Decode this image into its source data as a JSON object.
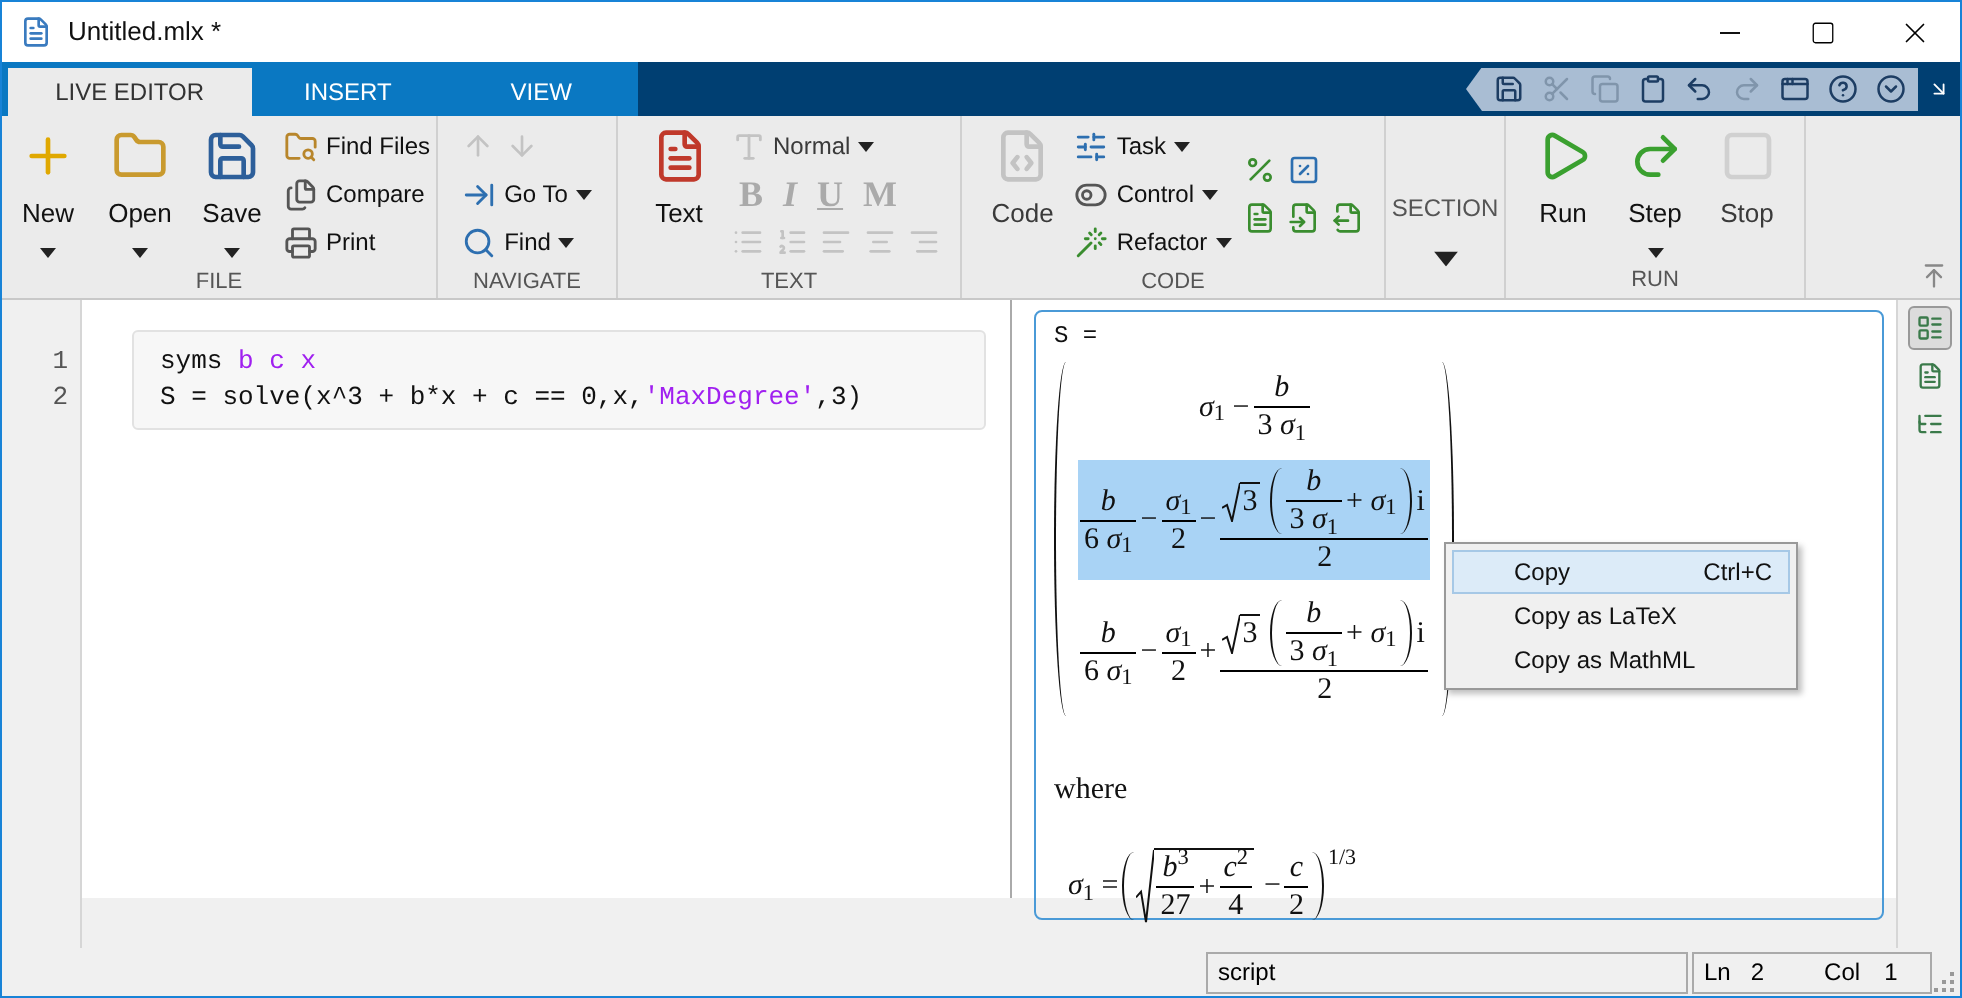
{
  "window": {
    "title": "Untitled.mlx *"
  },
  "tabs": [
    {
      "label": "LIVE EDITOR",
      "selected": true
    },
    {
      "label": "INSERT",
      "selected": false
    },
    {
      "label": "VIEW",
      "selected": false
    }
  ],
  "quick_access": [
    {
      "disabled": false
    },
    {
      "disabled": true
    },
    {
      "disabled": true
    },
    {
      "disabled": false
    },
    {
      "disabled": false
    },
    {
      "disabled": true
    },
    {
      "disabled": false
    },
    {
      "disabled": false
    },
    {
      "disabled": false
    }
  ],
  "ribbon": {
    "groups": [
      {
        "label": "FILE",
        "columns": [
          [
            {
              "kind": "large",
              "label": "New",
              "dropdown": true,
              "disabled": false
            }
          ],
          [
            {
              "kind": "large",
              "label": "Open",
              "dropdown": true,
              "disabled": false
            }
          ],
          [
            {
              "kind": "large",
              "label": "Save",
              "dropdown": true,
              "disabled": false
            }
          ],
          [
            {
              "kind": "small",
              "label": "Find Files",
              "dropdown": false,
              "disabled": false
            },
            {
              "kind": "small",
              "label": "Compare",
              "dropdown": false,
              "disabled": false
            },
            {
              "kind": "small",
              "label": "Print",
              "dropdown": false,
              "disabled": false
            }
          ]
        ]
      },
      {
        "label": "NAVIGATE",
        "columns": [
          [
            {
              "kind": "icons",
              "icons": [
                {
                  "disabled": true
                },
                {
                  "disabled": true
                }
              ]
            },
            {
              "kind": "small",
              "label": "Go To",
              "dropdown": true,
              "disabled": false
            },
            {
              "kind": "small",
              "label": "Find",
              "dropdown": true,
              "disabled": false
            }
          ]
        ]
      },
      {
        "label": "TEXT",
        "columns": [
          [
            {
              "kind": "large",
              "label": "Text",
              "dropdown": false,
              "disabled": false
            }
          ],
          [
            {
              "kind": "small",
              "label": "Normal",
              "dropdown": true,
              "disabled": true
            },
            {
              "kind": "glyphs",
              "glyphs": [
                {
                  "text": "B",
                  "disabled": true
                },
                {
                  "text": "I",
                  "disabled": true
                },
                {
                  "text": "U",
                  "disabled": true
                },
                {
                  "text": "M",
                  "disabled": true
                }
              ]
            },
            {
              "kind": "icons",
              "icons": [
                {
                  "disabled": true
                },
                {
                  "disabled": true
                },
                {
                  "disabled": true
                },
                {
                  "disabled": true
                },
                {
                  "disabled": true
                }
              ]
            }
          ]
        ]
      },
      {
        "label": "CODE",
        "columns": [
          [
            {
              "kind": "large",
              "label": "Code",
              "dropdown": false,
              "disabled": true
            }
          ],
          [
            {
              "kind": "small",
              "label": "Task",
              "dropdown": true,
              "disabled": false
            },
            {
              "kind": "small",
              "label": "Control",
              "dropdown": true,
              "disabled": false
            },
            {
              "kind": "small",
              "label": "Refactor",
              "dropdown": true,
              "disabled": false
            }
          ],
          [
            {
              "kind": "icons",
              "icons": [
                {
                  "disabled": false
                },
                {
                  "disabled": false
                }
              ]
            },
            {
              "kind": "icons",
              "icons": [
                {
                  "disabled": false
                },
                {
                  "disabled": false
                },
                {
                  "disabled": false
                }
              ]
            }
          ]
        ]
      },
      {
        "columns": [
          [
            {
              "kind": "section",
              "label": "SECTION",
              "dropdown": true
            }
          ]
        ]
      },
      {
        "label": "RUN",
        "columns": [
          [
            {
              "kind": "large",
              "label": "Run",
              "dropdown": false,
              "disabled": false
            }
          ],
          [
            {
              "kind": "large",
              "label": "Step",
              "dropdown": true,
              "disabled": false
            }
          ],
          [
            {
              "kind": "large",
              "label": "Stop",
              "dropdown": false,
              "disabled": true
            }
          ]
        ]
      }
    ]
  },
  "editor": {
    "lines": [
      {
        "number": "1",
        "tokens": [
          {
            "text": "syms ",
            "kind": "plain"
          },
          {
            "text": "b c x",
            "kind": "literal"
          }
        ]
      },
      {
        "number": "2",
        "tokens": [
          {
            "text": "S = solve(x^3 + b*x + c == 0,x,",
            "kind": "plain"
          },
          {
            "text": "'MaxDegree'",
            "kind": "literal"
          },
          {
            "text": ",3)",
            "kind": "plain"
          }
        ]
      }
    ]
  },
  "output": {
    "label": "S =",
    "rows": [
      {
        "selected": false,
        "expr": [
          {
            "kind": "t",
            "text": "*σ*$_{1}$ −"
          },
          {
            "kind": "frac",
            "num": [
              {
                "kind": "t",
                "text": "*b*"
              }
            ],
            "den": [
              {
                "kind": "t",
                "text": "3 *σ*$_{1}$"
              }
            ]
          }
        ]
      },
      {
        "selected": true,
        "expr": [
          {
            "kind": "frac",
            "num": [
              {
                "kind": "t",
                "text": "*b*"
              }
            ],
            "den": [
              {
                "kind": "t",
                "text": "6 *σ*$_{1}$"
              }
            ]
          },
          {
            "kind": "t",
            "text": "−"
          },
          {
            "kind": "frac",
            "num": [
              {
                "kind": "t",
                "text": "*σ*$_{1}$"
              }
            ],
            "den": [
              {
                "kind": "t",
                "text": "2"
              }
            ]
          },
          {
            "kind": "t",
            "text": "−"
          },
          {
            "kind": "frac",
            "num": [
              {
                "kind": "sqrt",
                "body": [
                  {
                    "kind": "t",
                    "text": "3"
                  }
                ]
              },
              {
                "kind": "paren",
                "body": [
                  {
                    "kind": "frac",
                    "num": [
                      {
                        "kind": "t",
                        "text": "*b*"
                      }
                    ],
                    "den": [
                      {
                        "kind": "t",
                        "text": "3 *σ*$_{1}$"
                      }
                    ]
                  },
                  {
                    "kind": "t",
                    "text": "+ *σ*$_{1}$"
                  }
                ]
              },
              {
                "kind": "t",
                "text": "i"
              }
            ],
            "den": [
              {
                "kind": "t",
                "text": "2"
              }
            ]
          }
        ]
      },
      {
        "selected": false,
        "expr": [
          {
            "kind": "frac",
            "num": [
              {
                "kind": "t",
                "text": "*b*"
              }
            ],
            "den": [
              {
                "kind": "t",
                "text": "6 *σ*$_{1}$"
              }
            ]
          },
          {
            "kind": "t",
            "text": "−"
          },
          {
            "kind": "frac",
            "num": [
              {
                "kind": "t",
                "text": "*σ*$_{1}$"
              }
            ],
            "den": [
              {
                "kind": "t",
                "text": "2"
              }
            ]
          },
          {
            "kind": "t",
            "text": "+"
          },
          {
            "kind": "frac",
            "num": [
              {
                "kind": "sqrt",
                "body": [
                  {
                    "kind": "t",
                    "text": "3"
                  }
                ]
              },
              {
                "kind": "paren",
                "body": [
                  {
                    "kind": "frac",
                    "num": [
                      {
                        "kind": "t",
                        "text": "*b*"
                      }
                    ],
                    "den": [
                      {
                        "kind": "t",
                        "text": "3 *σ*$_{1}$"
                      }
                    ]
                  },
                  {
                    "kind": "t",
                    "text": "+ *σ*$_{1}$"
                  }
                ]
              },
              {
                "kind": "t",
                "text": "i"
              }
            ],
            "den": [
              {
                "kind": "t",
                "text": "2"
              }
            ]
          }
        ]
      }
    ],
    "where": "where",
    "definition": [
      {
        "kind": "t",
        "text": "*σ*$_{1}$ ="
      },
      {
        "kind": "paren",
        "power": "1/3",
        "body": [
          {
            "kind": "sqrt",
            "body": [
              {
                "kind": "frac",
                "num": [
                  {
                    "kind": "t",
                    "text": "*b*$^{3}$"
                  }
                ],
                "den": [
                  {
                    "kind": "t",
                    "text": "27"
                  }
                ]
              },
              {
                "kind": "t",
                "text": "+"
              },
              {
                "kind": "frac",
                "num": [
                  {
                    "kind": "t",
                    "text": "*c*$^{2}$"
                  }
                ],
                "den": [
                  {
                    "kind": "t",
                    "text": "4"
                  }
                ]
              }
            ]
          },
          {
            "kind": "t",
            "text": "−"
          },
          {
            "kind": "frac",
            "num": [
              {
                "kind": "t",
                "text": "*c*"
              }
            ],
            "den": [
              {
                "kind": "t",
                "text": "2"
              }
            ]
          }
        ]
      }
    ]
  },
  "context_menu": [
    {
      "label": "Copy",
      "shortcut": "Ctrl+C",
      "selected": true
    },
    {
      "label": "Copy as LaTeX",
      "selected": false
    },
    {
      "label": "Copy as MathML",
      "selected": false
    }
  ],
  "output_modes": [
    {
      "selected": true
    },
    {
      "selected": false
    },
    {
      "selected": false
    }
  ],
  "status_bar": {
    "mode": "script",
    "line_label": "Ln",
    "line": "2",
    "col_label": "Col",
    "col": "1"
  }
}
